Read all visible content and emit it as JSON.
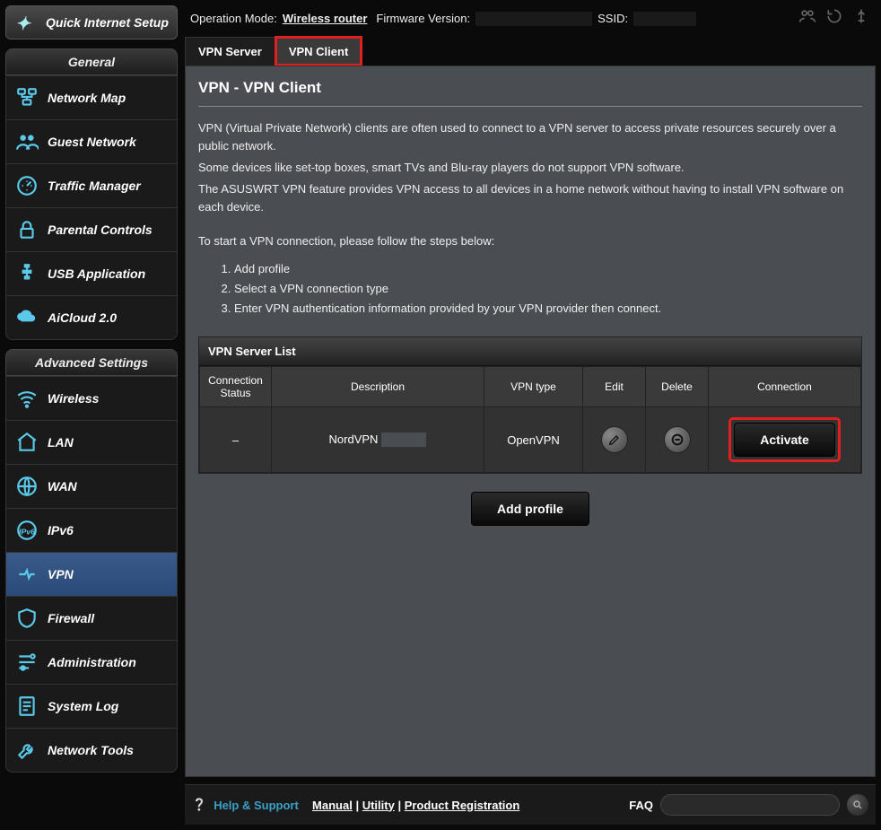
{
  "header": {
    "opmode_label": "Operation Mode:",
    "opmode_value": "Wireless router",
    "firmware_label": "Firmware Version:",
    "ssid_label": "SSID:"
  },
  "qis": {
    "label": "Quick Internet Setup"
  },
  "general": {
    "title": "General",
    "items": [
      {
        "id": "network-map",
        "label": "Network Map"
      },
      {
        "id": "guest-network",
        "label": "Guest Network"
      },
      {
        "id": "traffic-manager",
        "label": "Traffic Manager"
      },
      {
        "id": "parental-controls",
        "label": "Parental Controls"
      },
      {
        "id": "usb-application",
        "label": "USB Application"
      },
      {
        "id": "aicloud",
        "label": "AiCloud 2.0"
      }
    ]
  },
  "advanced": {
    "title": "Advanced Settings",
    "items": [
      {
        "id": "wireless",
        "label": "Wireless"
      },
      {
        "id": "lan",
        "label": "LAN"
      },
      {
        "id": "wan",
        "label": "WAN"
      },
      {
        "id": "ipv6",
        "label": "IPv6"
      },
      {
        "id": "vpn",
        "label": "VPN",
        "active": true
      },
      {
        "id": "firewall",
        "label": "Firewall"
      },
      {
        "id": "administration",
        "label": "Administration"
      },
      {
        "id": "system-log",
        "label": "System Log"
      },
      {
        "id": "network-tools",
        "label": "Network Tools"
      }
    ]
  },
  "tabs": {
    "server": "VPN Server",
    "client": "VPN Client"
  },
  "page": {
    "title": "VPN - VPN Client",
    "p1": "VPN (Virtual Private Network) clients are often used to connect to a VPN server to access private resources securely over a public network.",
    "p2": "Some devices like set-top boxes, smart TVs and Blu-ray players do not support VPN software.",
    "p3": "The ASUSWRT VPN feature provides VPN access to all devices in a home network without having to install VPN software on each device.",
    "steps_intro": "To start a VPN connection, please follow the steps below:",
    "steps": [
      "Add profile",
      "Select a VPN connection type",
      "Enter VPN authentication information provided by your VPN provider then connect."
    ]
  },
  "table": {
    "title": "VPN Server List",
    "headers": {
      "status": "Connection Status",
      "description": "Description",
      "vpntype": "VPN type",
      "edit": "Edit",
      "delete": "Delete",
      "connection": "Connection"
    },
    "row": {
      "status": "–",
      "description": "NordVPN",
      "vpntype": "OpenVPN",
      "activate": "Activate"
    }
  },
  "add_profile": "Add profile",
  "footer": {
    "help": "Help & Support",
    "manual": "Manual",
    "utility": "Utility",
    "product_reg": "Product Registration",
    "faq": "FAQ"
  }
}
